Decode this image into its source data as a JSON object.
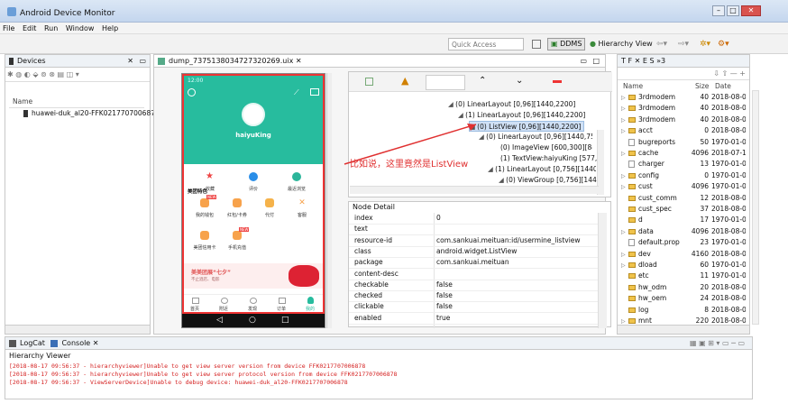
{
  "window": {
    "title": "Android Device Monitor",
    "min": "–",
    "max": "□",
    "close": "✕"
  },
  "menu": [
    "File",
    "Edit",
    "Run",
    "Window",
    "Help"
  ],
  "toolbar": {
    "quick_access": "Quick Access",
    "ddms_label": "DDMS",
    "hierarchy_label": "Hierarchy View"
  },
  "devices_panel": {
    "tab_label": "Devices",
    "column_name": "Name",
    "device": "huawei-duk_al20-FFK0217707006878"
  },
  "dump_tab": {
    "label": "dump_7375138034727320269.uix"
  },
  "phone": {
    "status": "12:00",
    "username": "haiyuKing",
    "quick_items": [
      "收藏",
      "评价",
      "最近浏览"
    ],
    "section_title": "美团特色",
    "grid_items": [
      "我的钱包",
      "红包/卡券",
      "代付",
      "客服",
      "美团信用卡",
      "手机充值"
    ],
    "badge_new": "NEW",
    "banner_text": "美美团展“七夕”",
    "banner_sub": "不止酒店、电影",
    "tabbar": [
      "首页",
      "附近",
      "发现",
      "订单",
      "我的"
    ]
  },
  "tree": {
    "nodes": [
      "(0) LinearLayout [0,96][1440,2200]",
      "(1) LinearLayout [0,96][1440,2200]",
      "(0) ListView [0,96][1440,2200]",
      "(0) LinearLayout [0,96][1440,756]",
      "(0) ImageView [600,300][840,5",
      "(1) TextView:haiyuKing [577,56",
      "(1) LinearLayout [0,756][1440,106",
      "(0) ViewGroup [0,756][1440,10"
    ],
    "annotation": "比如说，这里竟然是ListView"
  },
  "node_detail": {
    "title": "Node Detail",
    "rows": [
      {
        "key": "index",
        "value": "0"
      },
      {
        "key": "text",
        "value": ""
      },
      {
        "key": "resource-id",
        "value": "com.sankuai.meituan:id/usermine_listview"
      },
      {
        "key": "class",
        "value": "android.widget.ListView"
      },
      {
        "key": "package",
        "value": "com.sankuai.meituan"
      },
      {
        "key": "content-desc",
        "value": ""
      },
      {
        "key": "checkable",
        "value": "false"
      },
      {
        "key": "checked",
        "value": "false"
      },
      {
        "key": "clickable",
        "value": "false"
      },
      {
        "key": "enabled",
        "value": "true"
      }
    ]
  },
  "file_explorer": {
    "tabs": [
      "T",
      "F",
      "E",
      "S"
    ],
    "overflow": "»3",
    "columns": [
      "Name",
      "Size",
      "Date"
    ],
    "rows": [
      {
        "name": "3rdmodem",
        "size": "40",
        "date": "2018-08-0",
        "folder": true,
        "expand": true
      },
      {
        "name": "3rdmodem",
        "size": "40",
        "date": "2018-08-0",
        "folder": true,
        "expand": true
      },
      {
        "name": "3rdmodem",
        "size": "40",
        "date": "2018-08-0",
        "folder": true,
        "expand": true
      },
      {
        "name": "acct",
        "size": "0",
        "date": "2018-08-0",
        "folder": true,
        "expand": true
      },
      {
        "name": "bugreports",
        "size": "50",
        "date": "1970-01-0",
        "folder": false,
        "expand": false
      },
      {
        "name": "cache",
        "size": "4096",
        "date": "2018-07-1",
        "folder": true,
        "expand": true
      },
      {
        "name": "charger",
        "size": "13",
        "date": "1970-01-0",
        "folder": false,
        "expand": false
      },
      {
        "name": "config",
        "size": "0",
        "date": "1970-01-0",
        "folder": true,
        "expand": true
      },
      {
        "name": "cust",
        "size": "4096",
        "date": "1970-01-0",
        "folder": true,
        "expand": true
      },
      {
        "name": "cust_comm",
        "size": "12",
        "date": "2018-08-0",
        "folder": true,
        "expand": false
      },
      {
        "name": "cust_spec",
        "size": "37",
        "date": "2018-08-0",
        "folder": true,
        "expand": false
      },
      {
        "name": "d",
        "size": "17",
        "date": "1970-01-0",
        "folder": true,
        "expand": false
      },
      {
        "name": "data",
        "size": "4096",
        "date": "2018-08-0",
        "folder": true,
        "expand": true
      },
      {
        "name": "default.prop",
        "size": "23",
        "date": "1970-01-0",
        "folder": false,
        "expand": false
      },
      {
        "name": "dev",
        "size": "4160",
        "date": "2018-08-0",
        "folder": true,
        "expand": true
      },
      {
        "name": "dload",
        "size": "60",
        "date": "1970-01-0",
        "folder": true,
        "expand": true
      },
      {
        "name": "etc",
        "size": "11",
        "date": "1970-01-0",
        "folder": true,
        "expand": false
      },
      {
        "name": "hw_odm",
        "size": "20",
        "date": "2018-08-0",
        "folder": true,
        "expand": false
      },
      {
        "name": "hw_oem",
        "size": "24",
        "date": "2018-08-0",
        "folder": true,
        "expand": false
      },
      {
        "name": "log",
        "size": "8",
        "date": "2018-08-0",
        "folder": true,
        "expand": false
      },
      {
        "name": "mnt",
        "size": "220",
        "date": "2018-08-0",
        "folder": true,
        "expand": true
      }
    ]
  },
  "console": {
    "tabs": [
      "LogCat",
      "Console"
    ],
    "title": "Hierarchy Viewer",
    "lines": [
      "[2018-08-17 09:56:37 - hierarchyviewer]Unable to get view server version from device FFK0217707006878",
      "[2018-08-17 09:56:37 - hierarchyviewer]Unable to get view server protocol version from device FFK0217707006878",
      "[2018-08-17 09:56:37 - ViewServerDevice]Unable to debug device: huawei-duk_al20-FFK0217707006878"
    ]
  },
  "colors": {
    "accent": "#27bc9e",
    "error": "#d42020",
    "arrow": "#e03030",
    "highlight": "#cfe0f5"
  }
}
